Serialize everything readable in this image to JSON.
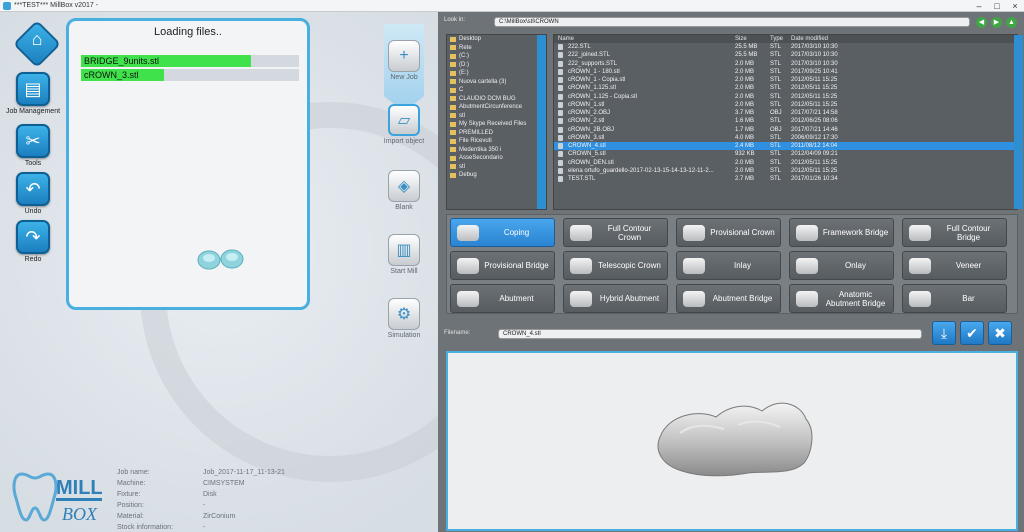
{
  "window": {
    "title": "***TEST*** MillBox v2017 -"
  },
  "sidebar": {
    "job_management": "Job Management",
    "tools": "Tools",
    "undo": "Undo",
    "redo": "Redo"
  },
  "loading": {
    "title": "Loading files..",
    "files": [
      {
        "name": "BRIDGE_9units.stl",
        "progress": 0.78
      },
      {
        "name": "cROWN_3.stl",
        "progress": 0.38
      }
    ]
  },
  "workflow": {
    "new_job": "New Job",
    "import_object": "Import object",
    "blank": "Blank",
    "start_mill": "Start Mill",
    "simulation": "Simulation"
  },
  "logo": {
    "top": "MILL",
    "bottom": "BOX"
  },
  "job_info": [
    {
      "key": "Job name:",
      "value": "Job_2017-11-17_11-13-21"
    },
    {
      "key": "Machine:",
      "value": "CIMSYSTEM"
    },
    {
      "key": "Fixture:",
      "value": "Disk"
    },
    {
      "key": "Position:",
      "value": "-"
    },
    {
      "key": "Material:",
      "value": "ZirConium"
    },
    {
      "key": "Stock information:",
      "value": "-"
    }
  ],
  "browser": {
    "look_in_label": "Look in:",
    "path": "C:\\MillBox\\stl\\CROWN",
    "tree": [
      "Desktop",
      "Rete",
      "(C:)",
      "(D:)",
      "(E:)",
      "Nuova cartella (3)",
      "C",
      "CLAUDIO DCM BUG",
      "AbutmentCircunference",
      "stl",
      "My Skype Received Files",
      "PREMILLED",
      "File Ricevuti",
      "Medentika 350 i",
      "AsseSecondario",
      "stl",
      "Debug"
    ],
    "columns": {
      "name": "Name",
      "size": "Size",
      "type": "Type",
      "date": "Date modified"
    },
    "files": [
      {
        "name": "222.STL",
        "size": "25.5 MB",
        "type": "STL",
        "date": "2017/03/10 10:30"
      },
      {
        "name": "222_joined.STL",
        "size": "25.5 MB",
        "type": "STL",
        "date": "2017/03/10 10:30"
      },
      {
        "name": "222_supports.STL",
        "size": "2.0 MB",
        "type": "STL",
        "date": "2017/03/10 10:30"
      },
      {
        "name": "cROWN_1 - 180.stl",
        "size": "2.0 MB",
        "type": "STL",
        "date": "2017/09/25 10:41"
      },
      {
        "name": "cROWN_1 - Copia.stl",
        "size": "2.0 MB",
        "type": "STL",
        "date": "2012/05/11 15:25"
      },
      {
        "name": "cROWN_1.125.stl",
        "size": "2.0 MB",
        "type": "STL",
        "date": "2012/05/11 15:25"
      },
      {
        "name": "cROWN_1.125 - Copia.stl",
        "size": "2.0 MB",
        "type": "STL",
        "date": "2012/05/11 15:25"
      },
      {
        "name": "cROWN_1.stl",
        "size": "2.0 MB",
        "type": "STL",
        "date": "2012/05/11 15:25"
      },
      {
        "name": "cROWN_2.OBJ",
        "size": "3.7 MB",
        "type": "OBJ",
        "date": "2017/07/21 14:58"
      },
      {
        "name": "cROWN_2.stl",
        "size": "1.6 MB",
        "type": "STL",
        "date": "2012/06/25 08:06"
      },
      {
        "name": "cROWN_2B.OBJ",
        "size": "1.7 MB",
        "type": "OBJ",
        "date": "2017/07/21 14:46"
      },
      {
        "name": "cROWN_3.stl",
        "size": "4.0 MB",
        "type": "STL",
        "date": "2006/09/12 17:30"
      },
      {
        "name": "CROWN_4.stl",
        "size": "2.4 MB",
        "type": "STL",
        "date": "2011/08/12 14:04",
        "selected": true
      },
      {
        "name": "CROWN_5.stl",
        "size": "932 KB",
        "type": "STL",
        "date": "2012/04/09 09:21"
      },
      {
        "name": "cROWN_DEN.stl",
        "size": "2.0 MB",
        "type": "STL",
        "date": "2012/05/11 15:25"
      },
      {
        "name": "elena ortufo_guardello-2017-02-13-15-14-13-12-11-2...",
        "size": "2.0 MB",
        "type": "STL",
        "date": "2012/05/11 15:25"
      },
      {
        "name": "TEST.STL",
        "size": "2.7 MB",
        "type": "STL",
        "date": "2017/01/26 10:34"
      }
    ]
  },
  "types": [
    [
      "Coping",
      "Full Contour Crown",
      "Provisional Crown",
      "Framework Bridge",
      "Full Contour Bridge"
    ],
    [
      "Provisional Bridge",
      "Telescopic Crown",
      "Inlay",
      "Onlay",
      "Veneer"
    ],
    [
      "Abutment",
      "Hybrid Abutment",
      "Abutment Bridge",
      "Anatomic Abutment Bridge",
      "Bar"
    ]
  ],
  "filename": {
    "label": "Filename:",
    "value": "CROWN_4.stl"
  }
}
